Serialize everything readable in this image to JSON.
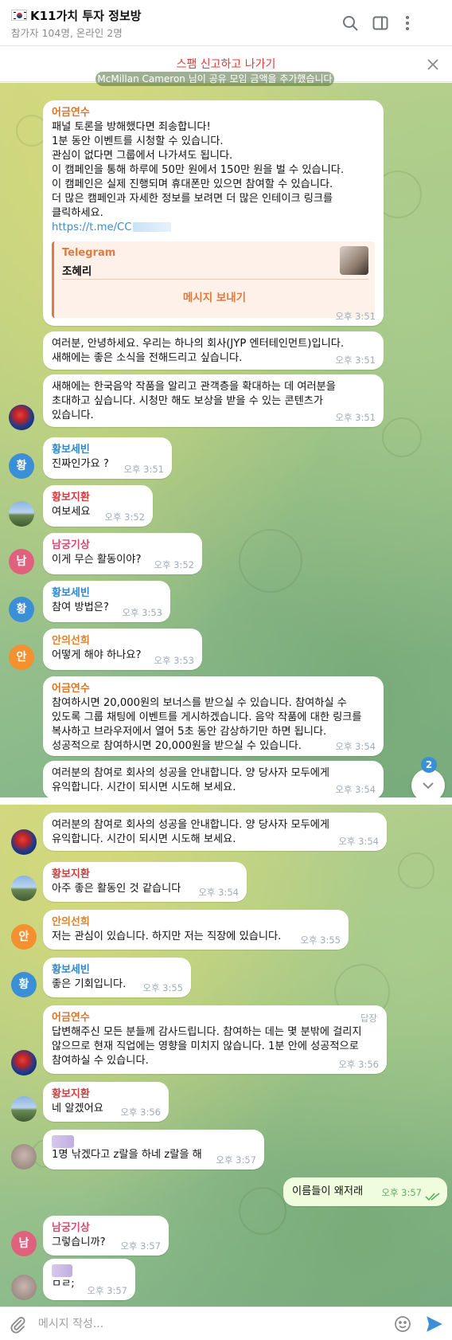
{
  "header": {
    "title": "K11가치 투자 정보방",
    "subtitle": "참가자 104명, 온라인 2명"
  },
  "spam_bar": {
    "label": "스팸 신고하고 나가기"
  },
  "pinned_notice": "McMillan Cameron 님이 공유 모임 금액을 추가했습니다",
  "messages": [
    {
      "sender": "어금연수",
      "sender_color": "#d9742b",
      "text": "패널 토론을 방해했다면 죄송합니다!\n1분 동안 이벤트를 시청할 수 있습니다.\n관심이 없다면 그룹에서 나가셔도 됩니다.\n이 캠페인을 통해 하루에 50만 원에서 150만 원을 벌 수 있습니다.\n이 캠페인은 실제 진행되며 휴대폰만 있으면 참여할 수 있습니다.\n더 많은 캠페인과 자세한 정보를 보려면 더 많은 인테이크 링크를\n클릭하세요.",
      "link": "https://t.me/CC",
      "preview": {
        "site": "Telegram",
        "title": "조혜리",
        "button": "메시지 보내기"
      },
      "time": "오후 3:51"
    },
    {
      "text": "여러분, 안녕하세요. 우리는 하나의 회사(JYP 엔터테인먼트)입니다.\n새해에는 좋은 소식을 전해드리고 싶습니다.",
      "time": "오후 3:51"
    },
    {
      "text": "새해에는 한국음악 작품을 알리고 관객층을 확대하는 데 여러분을\n초대하고 싶습니다. 시청만 해도 보상을 받을 수 있는 콘텐츠가\n있습니다.",
      "time": "오후 3:51"
    },
    {
      "sender": "황보세빈",
      "sender_color": "#2f87c9",
      "text": "진짜인가요 ?",
      "time": "오후 3:51",
      "avatar": "황"
    },
    {
      "sender": "황보지환",
      "sender_color": "#d13b3b",
      "text": "여보세요",
      "time": "오후 3:52"
    },
    {
      "sender": "남궁기상",
      "sender_color": "#d94a6d",
      "text": "이게 무슨 활동이야?",
      "time": "오후 3:52",
      "avatar": "남"
    },
    {
      "sender": "황보세빈",
      "sender_color": "#2f87c9",
      "text": "참여 방법은?",
      "time": "오후 3:53",
      "avatar": "황"
    },
    {
      "sender": "안의선희",
      "sender_color": "#e0822a",
      "text": "어떻게 해야 하나요?",
      "time": "오후 3:53",
      "avatar": "안"
    },
    {
      "sender": "어금연수",
      "sender_color": "#d9742b",
      "text": "참여하시면 20,000원의 보너스를 받으실 수 있습니다. 참여하실 수\n있도록 그룹 채팅에 이벤트를 게시하겠습니다. 음악 작품에 대한 링크를\n복사하고 브라우저에서 열어 5초 동안 감상하기만 하면 됩니다.\n성공적으로 참여하시면 20,000원을 받으실 수 있습니다.",
      "time": "오후 3:54"
    },
    {
      "text": "여러분의 참여로 회사의 성공을 안내합니다. 양 당사자 모두에게\n유익합니다. 시간이 되시면 시도해 보세요.",
      "time": "오후 3:54"
    },
    {
      "text": "여러분의 참여로 회사의 성공을 안내합니다. 양 당사자 모두에게\n유익합니다. 시간이 되시면 시도해 보세요.",
      "time": "오후 3:54"
    },
    {
      "sender": "황보지환",
      "sender_color": "#d13b3b",
      "text": "아주 좋은 활동인 것 같습니다",
      "time": "오후 3:54"
    },
    {
      "sender": "안의선희",
      "sender_color": "#e0822a",
      "text": "저는 관심이 있습니다. 하지만 저는 직장에 있습니다.",
      "time": "오후 3:55",
      "avatar": "안"
    },
    {
      "sender": "황보세빈",
      "sender_color": "#2f87c9",
      "text": "좋은 기회입니다.",
      "time": "오후 3:55",
      "avatar": "황"
    },
    {
      "sender": "어금연수",
      "sender_color": "#d9742b",
      "reply_tag": "답장",
      "text": "답변해주신 모든 분들께 감사드립니다. 참여하는 데는 몇 분밖에 걸리지\n않으므로 현재 직업에는 영향을 미치지 않습니다. 1분 안에 성공적으로\n참여하실 수 있습니다.",
      "time": "오후 3:56"
    },
    {
      "sender": "황보지환",
      "sender_color": "#d13b3b",
      "text": "네 알겠어요",
      "time": "오후 3:56"
    },
    {
      "text": "1명 낚겠다고 z랄을 하네 z랄을 해",
      "time": "오후 3:57"
    },
    {
      "text": "이름들이 왜저래",
      "time": "오후 3:57"
    },
    {
      "sender": "남궁기상",
      "sender_color": "#d94a6d",
      "text": "그렇습니까?",
      "time": "오후 3:57",
      "avatar": "남"
    },
    {
      "text": "ㅁㄹ;",
      "time": "오후 3:57"
    }
  ],
  "scroll_badge": "2",
  "composer": {
    "placeholder": "메시지 작성..."
  }
}
